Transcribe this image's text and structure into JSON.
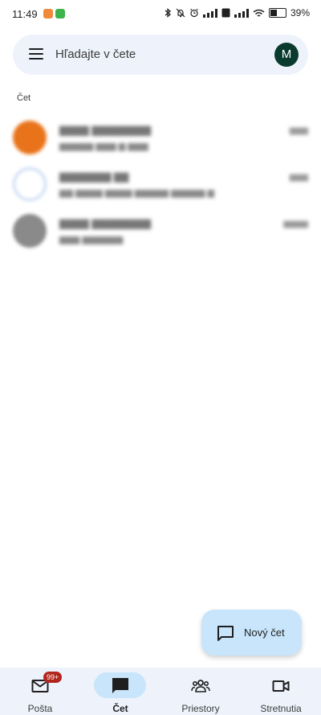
{
  "status_bar": {
    "time": "11:49",
    "battery": "39%",
    "battery_level": 0.39
  },
  "search": {
    "placeholder": "Hľadajte v čete",
    "avatar_initial": "M"
  },
  "section_label": "Čet",
  "fab": {
    "label": "Nový čet"
  },
  "nav": {
    "items": [
      {
        "label": "Pošta",
        "badge": "99+"
      },
      {
        "label": "Čet"
      },
      {
        "label": "Priestory"
      },
      {
        "label": "Stretnutia"
      }
    ]
  },
  "colors": {
    "accent": "#c8e5fb",
    "badge": "#b3261e",
    "avatar_m": "#0b3b2f",
    "surface": "#eef3fb"
  }
}
